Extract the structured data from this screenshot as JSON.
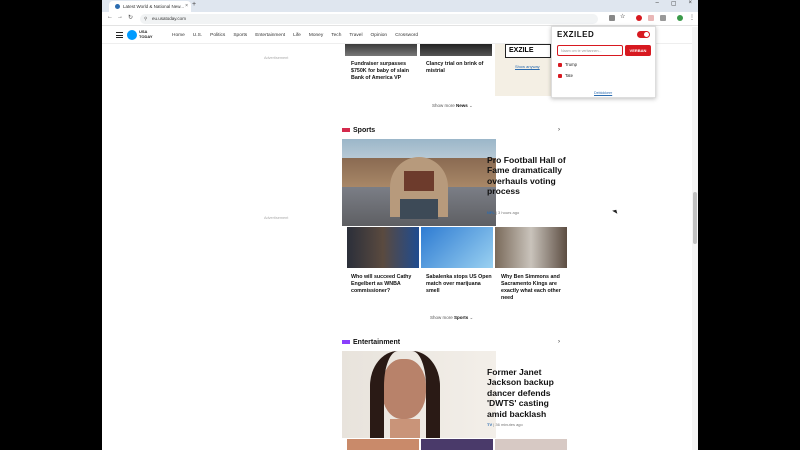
{
  "browser": {
    "tab_title": "Latest World & National New...",
    "tab_close": "×",
    "new_tab": "+",
    "url": "eu.usatoday.com",
    "window_controls": [
      "–",
      "▢",
      "×"
    ]
  },
  "site": {
    "logo": "USA TODAY",
    "menu": [
      "Home",
      "U.S.",
      "Politics",
      "Sports",
      "Entertainment",
      "Life",
      "Money",
      "Tech",
      "Travel",
      "Opinion",
      "Crossword"
    ],
    "ad_label": "Advertisement"
  },
  "news": {
    "stories": [
      "Fundraiser surpasses $750K for baby of slain Bank of America VP",
      "Clancy trial on brink of mistrial"
    ],
    "show_more": "Show more",
    "show_more_section": "News"
  },
  "sports": {
    "title": "Sports",
    "headline": "Pro Football Hall of Fame dramatically overhauls voting process",
    "meta_tag": "NFL",
    "meta_time": "3 hours ago",
    "stories": [
      "Who will succeed Cathy Engelbert as WNBA commissioner?",
      "Sabalenka stops US Open match over marijuana smell",
      "Why Ben Simmons and Sacramento Kings are exactly what each other need"
    ],
    "show_more": "Show more",
    "show_more_section": "Sports"
  },
  "entertainment": {
    "title": "Entertainment",
    "headline": "Former Janet Jackson backup dancer defends 'DWTS' casting amid backlash",
    "meta_tag": "TV",
    "meta_time": "36 minutes ago"
  },
  "extension": {
    "brand": "EXZILED",
    "input_placeholder": "Naam om te verbannen...",
    "button": "VERBAN",
    "items": [
      "Trump",
      "Tate"
    ],
    "link": "Deblokkeer"
  },
  "ad_card": {
    "logo": "EXZILE",
    "link": "Show anyway"
  },
  "colors": {
    "sports_accent": "#d42a4c",
    "entertainment_accent": "#8a3ffc",
    "extension_red": "#d71920"
  }
}
